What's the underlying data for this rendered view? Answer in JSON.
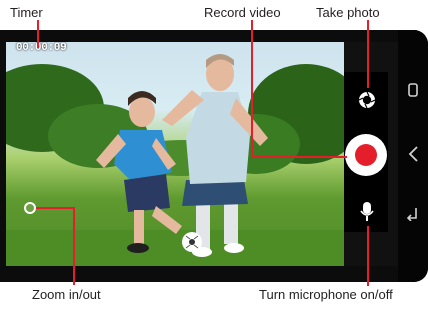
{
  "callouts": {
    "timer": "Timer",
    "record_video": "Record video",
    "take_photo": "Take photo",
    "zoom": "Zoom in/out",
    "microphone": "Turn microphone on/off"
  },
  "camera": {
    "timer": "00:00:09",
    "scene_description": "father and son playing soccer in a park"
  },
  "icons": {
    "take_photo": "camera-shutter-icon",
    "record": "record-icon",
    "microphone": "microphone-icon",
    "zoom": "zoom-handle-icon",
    "nav_recent": "recent-apps-icon",
    "nav_home": "home-icon",
    "nav_back": "back-icon"
  },
  "colors": {
    "callout_line": "#e41e2a",
    "record": "#e41e2a"
  }
}
